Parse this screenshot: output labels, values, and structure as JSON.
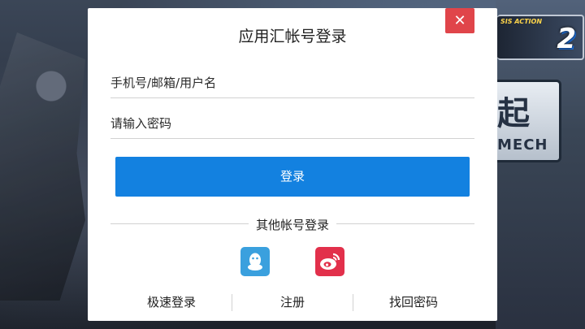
{
  "dialog": {
    "title": "应用汇帐号登录",
    "username_placeholder": "手机号/邮箱/用户名",
    "username_value": "",
    "password_placeholder": "请输入密码",
    "password_value": "",
    "login_label": "登录",
    "other_login_label": "其他帐号登录",
    "social": [
      {
        "name": "qq",
        "icon": "qq-icon",
        "color": "#3aa0de"
      },
      {
        "name": "weibo",
        "icon": "weibo-icon",
        "color": "#e2304b"
      }
    ],
    "links": {
      "quick_login": "极速登录",
      "register": "注册",
      "find_password": "找回密码"
    },
    "close_icon": "close-icon",
    "colors": {
      "accent": "#1381e0",
      "close": "#e0454a"
    }
  },
  "background": {
    "logo_tag": "SIS ACTION",
    "logo_number": "2",
    "badge_text": "起",
    "badge_sub": "MECH"
  }
}
